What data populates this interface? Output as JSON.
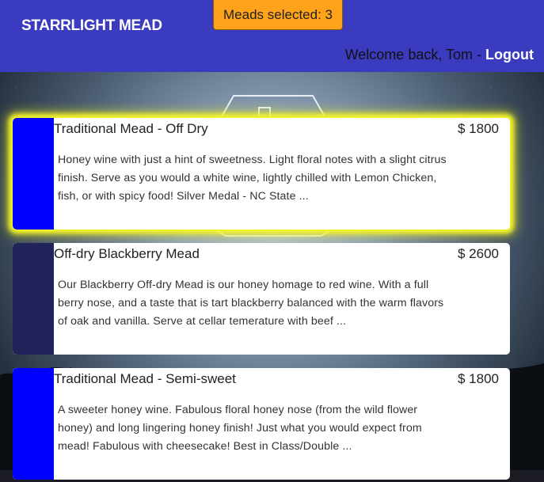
{
  "app": {
    "brand": "STARRLIGHT MEAD"
  },
  "header": {
    "selected_counter": "Meads selected: 3",
    "welcome_text": "Welcome back, Tom - ",
    "logout_label": "Logout"
  },
  "meads": [
    {
      "name": "Traditional Mead - Off Dry",
      "price": "$ 1800",
      "description": "Honey wine with just a hint of sweetness. Light floral notes with a slight citrus finish. Serve as you would a white wine, lightly chilled with Lemon Chicken, fish, or with spicy food! Silver Medal - NC State ...",
      "swatch_color": "#0000ff",
      "selected": true
    },
    {
      "name": "Off-dry Blackberry Mead",
      "price": "$ 2600",
      "description": "Our Blackberry Off-dry Mead is our honey homage to red wine. With a full berry nose, and a taste that is tart blackberry balanced with the warm flavors of oak and vanilla. Serve at cellar temerature with beef ...",
      "swatch_color": "#22235a",
      "selected": false
    },
    {
      "name": "Traditional Mead - Semi-sweet",
      "price": "$ 1800",
      "description": "A sweeter honey wine. Fabulous floral honey nose (from the wild flower honey) and long lingering honey finish! Just what you would expect from mead! Fabulous with cheesecake! Best in Class/Double ...",
      "swatch_color": "#0000ff",
      "selected": false
    }
  ]
}
